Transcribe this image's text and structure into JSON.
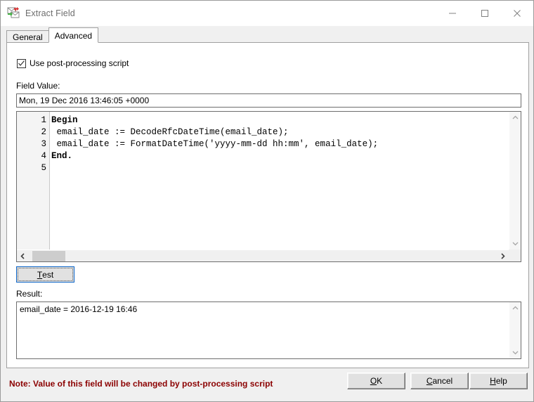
{
  "window": {
    "title": "Extract Field",
    "icon": "extract-field-icon",
    "controls": {
      "minimize": "minimize-icon",
      "maximize": "maximize-icon",
      "close": "close-icon"
    }
  },
  "tabs": [
    {
      "label": "General",
      "active": false
    },
    {
      "label": "Advanced",
      "active": true
    }
  ],
  "form": {
    "use_script_checkbox": {
      "label": "Use post-processing script",
      "checked": true
    },
    "field_value_label": "Field Value:",
    "field_value": "Mon, 19 Dec 2016 13:46:05 +0000",
    "result_label": "Result:",
    "result_value": "email_date = 2016-12-19 16:46"
  },
  "editor": {
    "lines": [
      {
        "num": "1",
        "text": "Begin",
        "bold": true
      },
      {
        "num": "2",
        "text": " email_date := DecodeRfcDateTime(email_date);",
        "bold": false
      },
      {
        "num": "3",
        "text": " email_date := FormatDateTime('yyyy-mm-dd hh:mm', email_date);",
        "bold": false
      },
      {
        "num": "4",
        "text": "End.",
        "bold": true
      },
      {
        "num": "5",
        "text": "",
        "bold": false
      }
    ],
    "scroll_up_icon": "chevron-up-icon",
    "scroll_down_icon": "chevron-down-icon",
    "scroll_left_icon": "chevron-left-icon",
    "scroll_right_icon": "chevron-right-icon"
  },
  "buttons": {
    "test": {
      "prefix": "",
      "accel": "T",
      "suffix": "est"
    },
    "ok": {
      "prefix": "",
      "accel": "O",
      "suffix": "K"
    },
    "cancel": {
      "prefix": "",
      "accel": "C",
      "suffix": "ancel"
    },
    "help": {
      "prefix": "",
      "accel": "H",
      "suffix": "elp"
    }
  },
  "footer": {
    "note": "Note: Value of this field will be changed by post-processing script",
    "note_color": "#8b0000"
  }
}
